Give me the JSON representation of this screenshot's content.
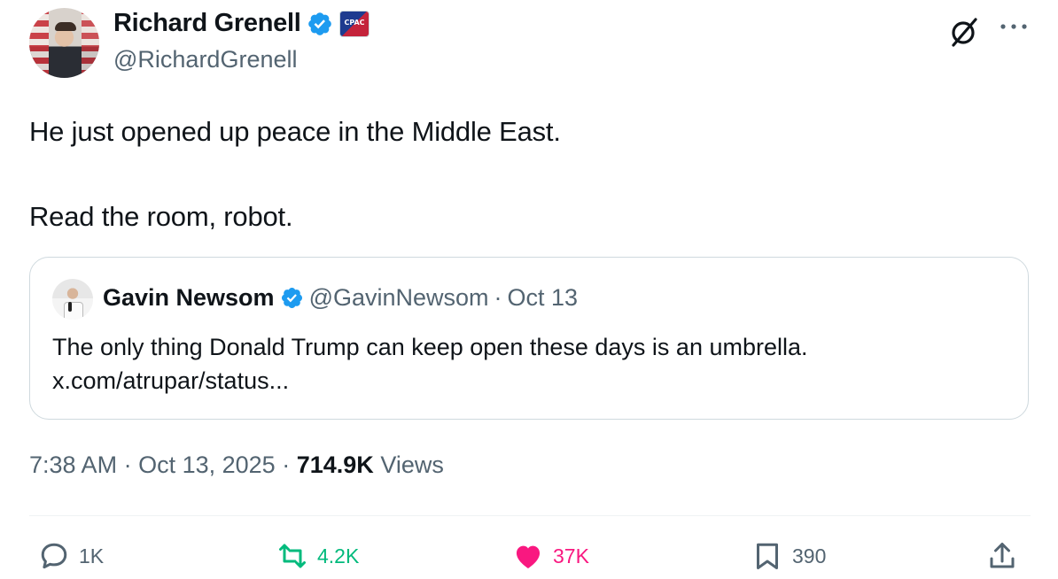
{
  "author": {
    "name": "Richard Grenell",
    "handle": "@RichardGrenell",
    "affiliation_badge_text": "CPAC"
  },
  "tweet": {
    "lines": [
      "He just opened up peace in the Middle East.",
      "Read the room, robot."
    ]
  },
  "quote": {
    "name": "Gavin Newsom",
    "handle": "@GavinNewsom",
    "separator": "·",
    "date": "Oct 13",
    "text_line1": "The only thing Donald Trump can keep open these days is an umbrella.",
    "text_line2": "x.com/atrupar/status..."
  },
  "timestamp": {
    "time": "7:38 AM",
    "separator1": "·",
    "date": "Oct 13, 2025",
    "separator2": "·",
    "views_count": "714.9K",
    "views_label": "Views"
  },
  "actions": {
    "replies": "1K",
    "reposts": "4.2K",
    "likes": "37K",
    "bookmarks": "390"
  },
  "colors": {
    "verified": "#1d9bf0",
    "repost": "#00ba7c",
    "like": "#f91880",
    "text_secondary": "#536471"
  },
  "icons": [
    "grok-icon",
    "more-icon",
    "reply-icon",
    "repost-icon",
    "like-icon",
    "bookmark-icon",
    "share-icon",
    "verified-icon"
  ]
}
